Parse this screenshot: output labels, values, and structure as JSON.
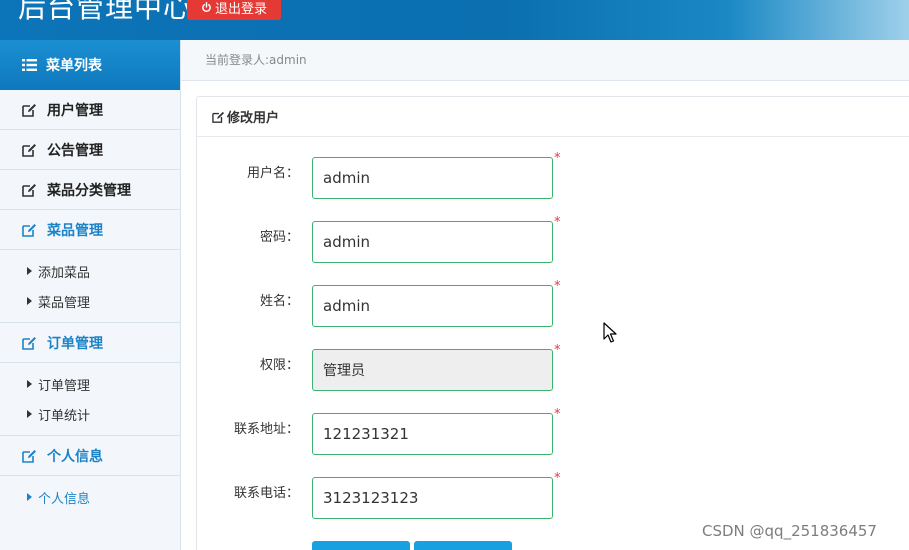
{
  "header": {
    "title": "后台管理中心",
    "logout_label": "退出登录"
  },
  "sidebar": {
    "head_label": "菜单列表",
    "sections": [
      {
        "label": "用户管理",
        "active": false,
        "items": []
      },
      {
        "label": "公告管理",
        "active": false,
        "items": []
      },
      {
        "label": "菜品分类管理",
        "active": false,
        "items": []
      },
      {
        "label": "菜品管理",
        "active": true,
        "items": [
          "添加菜品",
          "菜品管理"
        ]
      },
      {
        "label": "订单管理",
        "active": true,
        "items": [
          "订单管理",
          "订单统计"
        ]
      },
      {
        "label": "个人信息",
        "active": true,
        "items": [
          "个人信息"
        ]
      }
    ]
  },
  "breadcrumb": "当前登录人:admin",
  "panel": {
    "title": "修改用户",
    "fields": [
      {
        "label": "用户名：",
        "value": "admin",
        "disabled": false
      },
      {
        "label": "密码：",
        "value": "admin",
        "disabled": false
      },
      {
        "label": "姓名：",
        "value": "admin",
        "disabled": false
      },
      {
        "label": "权限：",
        "value": "管理员",
        "disabled": true
      },
      {
        "label": "联系地址：",
        "value": "121231321",
        "disabled": false
      },
      {
        "label": "联系电话：",
        "value": "3123123123",
        "disabled": false
      }
    ],
    "required_mark": "*"
  },
  "watermark": "CSDN @qq_251836457",
  "colors": {
    "header_blue": "#0c74b8",
    "logout_red": "#e53935",
    "active_blue": "#1d83c7",
    "input_border": "#3cb371",
    "button_blue": "#19a0e0"
  }
}
